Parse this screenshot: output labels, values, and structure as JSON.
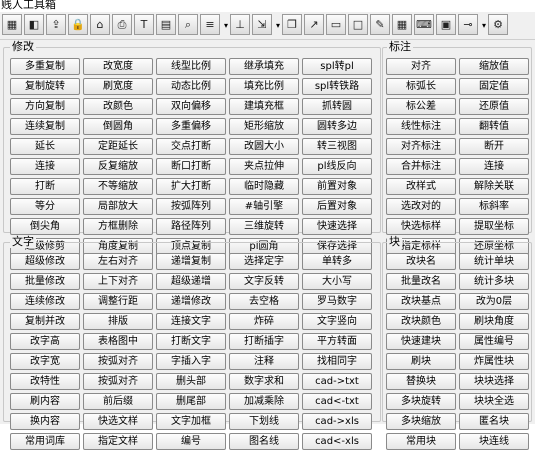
{
  "window": {
    "title": "贱人工具箱"
  },
  "toolbar": {
    "items": [
      {
        "icon": "grid-icon",
        "glyph": "▦"
      },
      {
        "icon": "layers-icon",
        "glyph": "◧"
      },
      {
        "icon": "upload-icon",
        "glyph": "⇪"
      },
      {
        "icon": "lock-icon",
        "glyph": "🔒"
      },
      {
        "icon": "home-icon",
        "glyph": "⌂"
      },
      {
        "icon": "print-icon",
        "glyph": "⎙"
      },
      {
        "icon": "text-icon",
        "glyph": "T"
      },
      {
        "icon": "table-icon",
        "glyph": "▤"
      },
      {
        "icon": "zoom-icon",
        "glyph": "⌕"
      },
      {
        "icon": "ruler-icon",
        "glyph": "≡"
      },
      {
        "icon": "measure-icon",
        "glyph": "⊥"
      },
      {
        "icon": "move-icon",
        "glyph": "⇲"
      },
      {
        "icon": "copy-icon",
        "glyph": "❐"
      },
      {
        "icon": "arrow-icon",
        "glyph": "↗"
      },
      {
        "icon": "document-icon",
        "glyph": "▭"
      },
      {
        "icon": "rectangle-icon",
        "glyph": "□"
      },
      {
        "icon": "pencil-icon",
        "glyph": "✎"
      },
      {
        "icon": "layout-icon",
        "glyph": "▦"
      },
      {
        "icon": "keyboard-icon",
        "glyph": "⌨"
      },
      {
        "icon": "fill-icon",
        "glyph": "▣"
      },
      {
        "icon": "link-icon",
        "glyph": "⊸"
      },
      {
        "icon": "settings-icon",
        "glyph": "⚙"
      }
    ],
    "dropdown_glyph": "▾"
  },
  "sections": {
    "modify": {
      "label": "修改",
      "buttons": [
        "多重复制",
        "改宽度",
        "线型比例",
        "继承填充",
        "spl转pl",
        "复制旋转",
        "刷宽度",
        "动态比例",
        "填充比例",
        "spl转铁路",
        "方向复制",
        "改颜色",
        "双向偏移",
        "建填充框",
        "抓转圆",
        "连续复制",
        "倒圆角",
        "多重偏移",
        "矩形缩放",
        "圆转多边",
        "延长",
        "定距延长",
        "交点打断",
        "改圆大小",
        "转三视图",
        "连接",
        "反复缩放",
        "断口打断",
        "夹点拉伸",
        "pl线反向",
        "打断",
        "不等缩放",
        "扩大打断",
        "临时隐藏",
        "前置对象",
        "等分",
        "局部放大",
        "按弧阵列",
        "#轴引擎",
        "后置对象",
        "倒尖角",
        "方框删除",
        "路径阵列",
        "三维旋转",
        "快速选择",
        "超级修剪",
        "角度复制",
        "顶点复制",
        "pl圆角",
        "保存选择"
      ]
    },
    "annotate": {
      "label": "标注",
      "buttons": [
        "对齐",
        "缩放值",
        "标弧长",
        "固定值",
        "标公差",
        "还原值",
        "线性标注",
        "翻转值",
        "对齐标注",
        "断开",
        "合并标注",
        "连接",
        "改样式",
        "解除关联",
        "选改对的",
        "标斜率",
        "快选标样",
        "提取坐标",
        "指定标样",
        "还原坐标"
      ]
    },
    "text": {
      "label": "文字",
      "buttons": [
        "超级修改",
        "左右对齐",
        "递增复制",
        "选择定字",
        "单转多",
        "批量修改",
        "上下对齐",
        "超级递增",
        "文字反转",
        "大小写",
        "连续修改",
        "调整行距",
        "递增修改",
        "去空格",
        "罗马数字",
        "复制并改",
        "排版",
        "连接文字",
        "炸碎",
        "文字竖向",
        "改字高",
        "表格图中",
        "打断文字",
        "打断插字",
        "平方转面",
        "改字宽",
        "按弧对齐",
        "字插入字",
        "注释",
        "找相同字",
        "改特性",
        "按弧对齐",
        "删头部",
        "数字求和",
        "cad->txt",
        "刷内容",
        "前后缀",
        "删尾部",
        "加减乘除",
        "cad<-txt",
        "换内容",
        "快选文样",
        "文字加框",
        "下划线",
        "cad->xls",
        "常用词库",
        "指定文样",
        "编号",
        "图名线",
        "cad<-xls"
      ]
    },
    "block": {
      "label": "块",
      "buttons": [
        "改块名",
        "统计单块",
        "批量改名",
        "统计多块",
        "改块基点",
        "改为0层",
        "改块颜色",
        "刷块角度",
        "快速建块",
        "属性编号",
        "刷块",
        "炸属性块",
        "替换块",
        "块块选择",
        "多块旋转",
        "块块全选",
        "多块缩放",
        "匿名块",
        "常用块",
        "块连线"
      ]
    }
  }
}
